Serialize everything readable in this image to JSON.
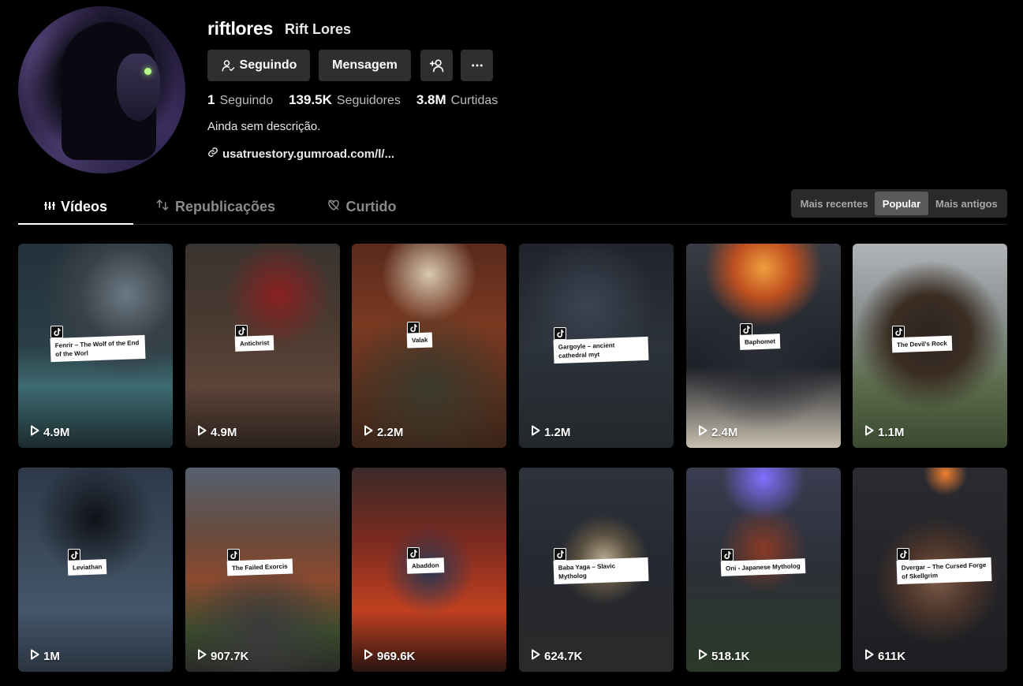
{
  "profile": {
    "username": "riftlores",
    "nickname": "Rift Lores",
    "bio": "Ainda sem descrição.",
    "link": "usatruestory.gumroad.com/l/..."
  },
  "buttons": {
    "following": "Seguindo",
    "message": "Mensagem"
  },
  "stats": [
    {
      "value": "1",
      "label": "Seguindo"
    },
    {
      "value": "139.5K",
      "label": "Seguidores"
    },
    {
      "value": "3.8M",
      "label": "Curtidas"
    }
  ],
  "tabs": [
    {
      "label": "Vídeos",
      "active": true
    },
    {
      "label": "Republicações",
      "active": false
    },
    {
      "label": "Curtido",
      "active": false
    }
  ],
  "sort": {
    "options": [
      "Mais recentes",
      "Popular",
      "Mais antigos"
    ],
    "selected": "Popular"
  },
  "videos": [
    {
      "title": "Fenrir – The Wolf of the End of the Worl",
      "views": "4.9M"
    },
    {
      "title": "Antichrist",
      "views": "4.9M"
    },
    {
      "title": "Valak",
      "views": "2.2M"
    },
    {
      "title": "Gargoyle – ancient cathedral myt",
      "views": "1.2M"
    },
    {
      "title": "Baphomet",
      "views": "2.4M"
    },
    {
      "title": "The Devil's Rock",
      "views": "1.1M"
    },
    {
      "title": "Leviathan",
      "views": "1M"
    },
    {
      "title": "The Failed Exorcis",
      "views": "907.7K"
    },
    {
      "title": "Abaddon",
      "views": "969.6K"
    },
    {
      "title": "Baba Yaga – Slavic Mytholog",
      "views": "624.7K"
    },
    {
      "title": "Oni - Japanese Mytholog",
      "views": "518.1K"
    },
    {
      "title": "Dvergar – The Cursed Forge of Skellgrim",
      "views": "611K"
    }
  ],
  "colors": {
    "background": "#000000",
    "button": "#2f2f2f",
    "muted_text": "#8a8a8a"
  }
}
